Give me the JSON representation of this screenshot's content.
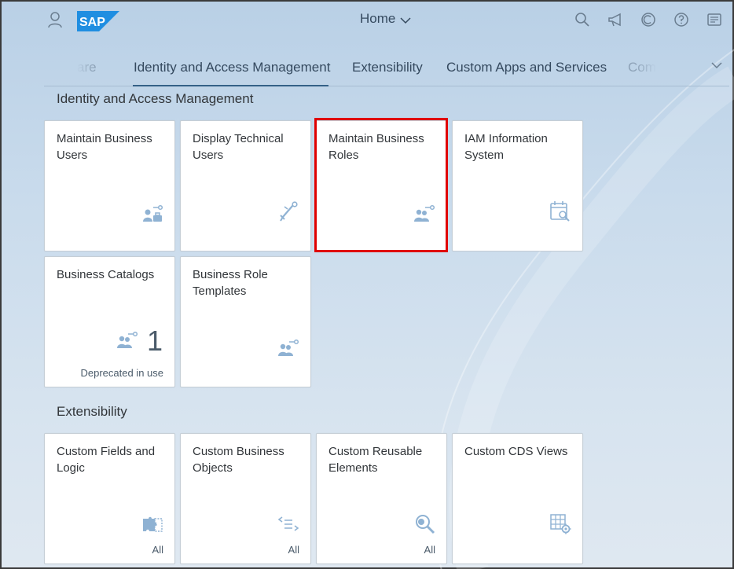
{
  "shell": {
    "logo_text": "SAP",
    "home_label": "Home",
    "icons": [
      "user-icon",
      "sap-logo",
      "chevron-down-icon",
      "search-icon",
      "megaphone-icon",
      "copilot-icon",
      "help-icon",
      "notifications-icon"
    ]
  },
  "anchor_tabs": [
    {
      "label": "are"
    },
    {
      "label": "Identity and Access Management"
    },
    {
      "label": "Extensibility"
    },
    {
      "label": "Custom Apps and Services"
    },
    {
      "label": "Com"
    }
  ],
  "sections": [
    {
      "title": "Identity and Access Management",
      "tiles": [
        {
          "title": "Maintain Business Users",
          "icon": "business-user-key-icon"
        },
        {
          "title": "Display Technical Users",
          "icon": "wrench-key-icon"
        },
        {
          "title": "Maintain Business Roles",
          "icon": "group-key-icon"
        },
        {
          "title": "IAM Information System",
          "icon": "calendar-search-icon"
        },
        {
          "title": "Business Catalogs",
          "icon": "group-key-icon",
          "number": "1",
          "footer": "Deprecated in use"
        },
        {
          "title": "Business Role Templates",
          "icon": "group-key-icon"
        }
      ]
    },
    {
      "title": "Extensibility",
      "tiles": [
        {
          "title": "Custom Fields and Logic",
          "icon": "puzzle-icon",
          "footer": "All"
        },
        {
          "title": "Custom Business Objects",
          "icon": "code-list-icon",
          "footer": "All"
        },
        {
          "title": "Custom Reusable Elements",
          "icon": "wrench-search-icon",
          "footer": "All"
        },
        {
          "title": "Custom CDS Views",
          "icon": "table-gear-icon"
        }
      ]
    }
  ],
  "colors": {
    "shell_text": "#354a5f",
    "icon_blue": "#8fb2d3",
    "highlight": "#e00000",
    "sap_blue": "#1f8ee1"
  }
}
